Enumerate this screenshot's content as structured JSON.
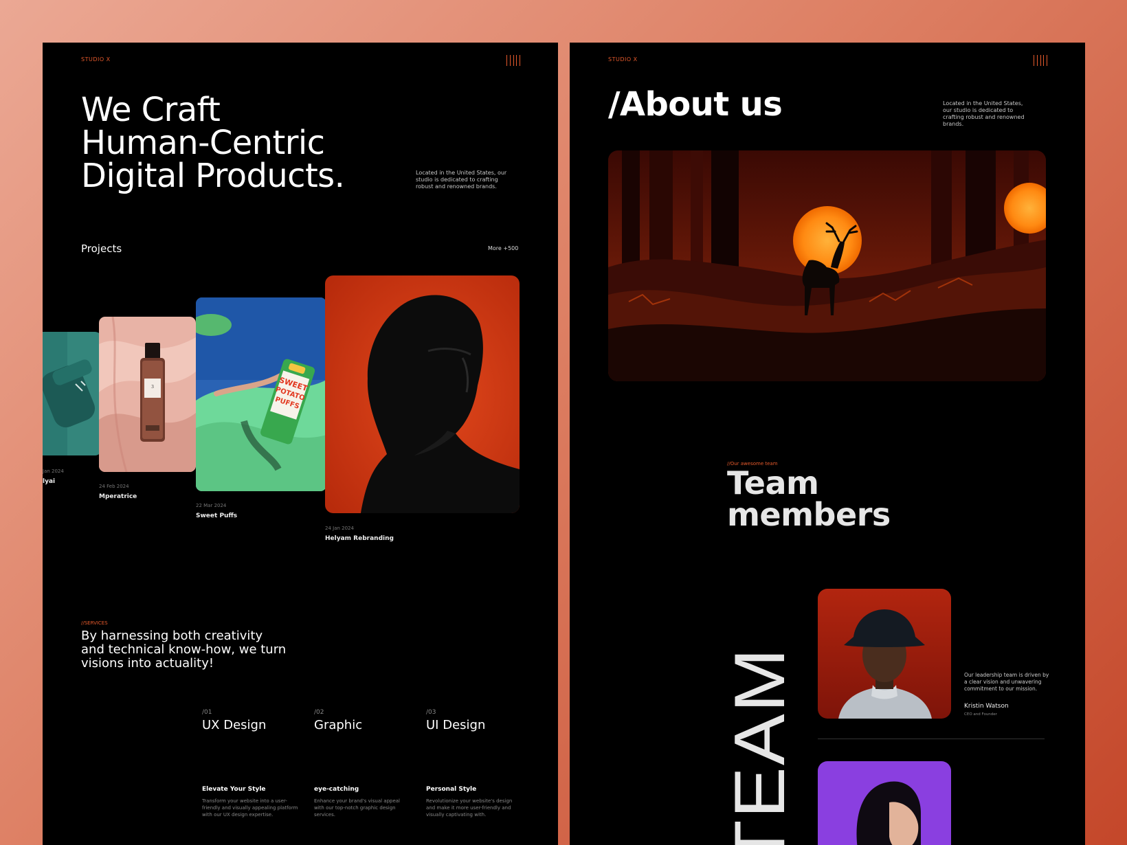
{
  "left": {
    "brand": "STUDIO X",
    "hero_lines": [
      "We Craft",
      "Human-Centric",
      "Digital Products."
    ],
    "hero_desc": "Located in the United States, our studio is dedicated to crafting robust and renowned brands.",
    "projects_heading": "Projects",
    "projects_more": "More +500",
    "projects": [
      {
        "date": "Jan 2024",
        "name": "lyai"
      },
      {
        "date": "24 Feb 2024",
        "name": "Mperatrice"
      },
      {
        "date": "22 Mar 2024",
        "name": "Sweet Puffs"
      },
      {
        "date": "24 Jan 2024",
        "name": "Helyam Rebranding"
      }
    ],
    "services_label": "//SERVICES",
    "services_text": "By harnessing both creativity and technical know-how, we turn visions into actuality!",
    "services": [
      {
        "num": "/01",
        "title": "UX Design",
        "subtitle": "Elevate Your Style",
        "desc": "Transform your website into a user-friendly and visually appealing platform with our UX design expertise."
      },
      {
        "num": "/02",
        "title": "Graphic",
        "subtitle": "eye-catching",
        "desc": "Enhance your brand's visual appeal with our top-notch graphic design services."
      },
      {
        "num": "/03",
        "title": "UI Design",
        "subtitle": "Personal Style",
        "desc": "Revolutionize your website's design and make it more user-friendly and visually captivating with."
      }
    ]
  },
  "right": {
    "brand": "STUDIO X",
    "about_title": "/About us",
    "about_desc": "Located in the United States, our studio is dedicated to crafting robust and renowned brands.",
    "team_label": "//Our awesome team",
    "team_title_lines": [
      "Team",
      "members"
    ],
    "team_vertical": "TEAM",
    "quote": "Our leadership team is driven by a clear vision and unwavering commitment to our mission.",
    "member_name": "Kristin Watson",
    "member_role": "CEO and Founder"
  },
  "colors": {
    "accent": "#e65a2c",
    "panel_bg": "#000000",
    "backdrop": "#dd7f63"
  },
  "icons": [
    "menu-icon"
  ]
}
